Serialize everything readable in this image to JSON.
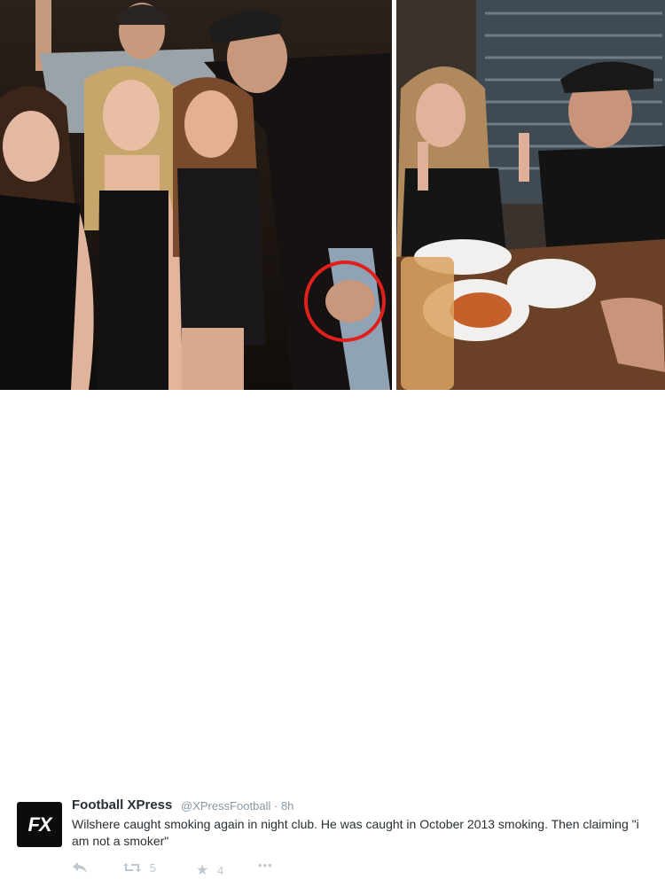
{
  "tweet": {
    "avatar_text": "FX",
    "name": "Football XPress",
    "handle": "@XPressFootball",
    "separator": "·",
    "time": "8h",
    "text": "Wilshere caught smoking again in night club. He was caught in October 2013 smoking. Then claiming \"i am not a smoker\"",
    "retweet_count": "5",
    "favorite_count": "4"
  },
  "icons": [
    "reply-icon",
    "retweet-icon",
    "favorite-icon",
    "more-icon"
  ],
  "colors": {
    "name": "#292f33",
    "meta": "#8899a6",
    "action": "#bfc7cf",
    "highlight_circle": "#e0201c"
  }
}
